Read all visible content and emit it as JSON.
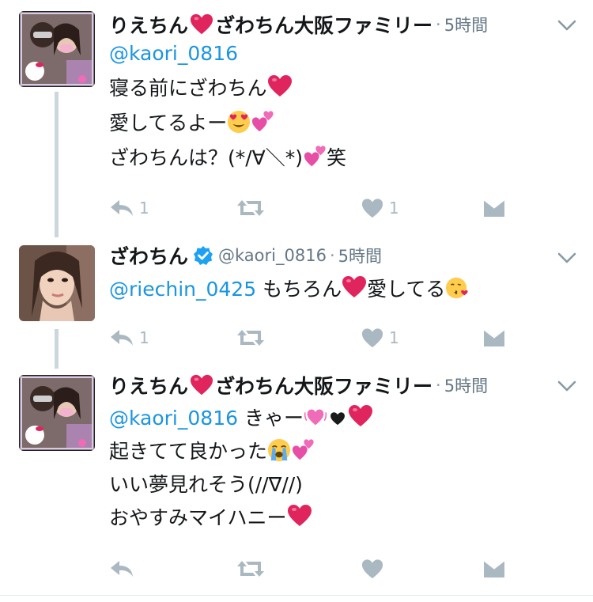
{
  "tweets": [
    {
      "name": "りえちん",
      "name_suffix": "ざわちん大阪ファミリー",
      "handle": "",
      "time": "5時間",
      "reply_to": "@kaori_0816",
      "lines": [
        "寝る前にざわちん",
        "愛してるよー",
        "ざわちんは？(*/∀＼*)",
        "笑"
      ],
      "reply_count": "1",
      "retweet_count": "",
      "like_count": "1"
    },
    {
      "name": "ざわちん",
      "handle": "@kaori_0816",
      "time": "5時間",
      "reply_to": "@riechin_0425",
      "lines": [
        "もちろん",
        "愛してる"
      ],
      "reply_count": "1",
      "retweet_count": "",
      "like_count": "1"
    },
    {
      "name": "りえちん",
      "name_suffix": "ざわちん大阪ファミリー",
      "handle": "",
      "time": "5時間",
      "reply_to": "@kaori_0816",
      "lines": [
        "きゃー",
        "起きてて良かった",
        "いい夢見れそう(//∇//)",
        "おやすみマイハニー"
      ],
      "reply_count": "",
      "retweet_count": "",
      "like_count": ""
    }
  ],
  "icons": {
    "reply": "reply-icon",
    "retweet": "retweet-icon",
    "like": "heart-icon",
    "dm": "dm-envelope-icon",
    "more": "chevron-down-icon",
    "verified": "verified-badge-icon"
  },
  "colors": {
    "mention": "#1b95e0",
    "action": "#aab8c2",
    "meta": "#657786",
    "verified": "#1da1f2",
    "red_heart": "#e0245e"
  }
}
